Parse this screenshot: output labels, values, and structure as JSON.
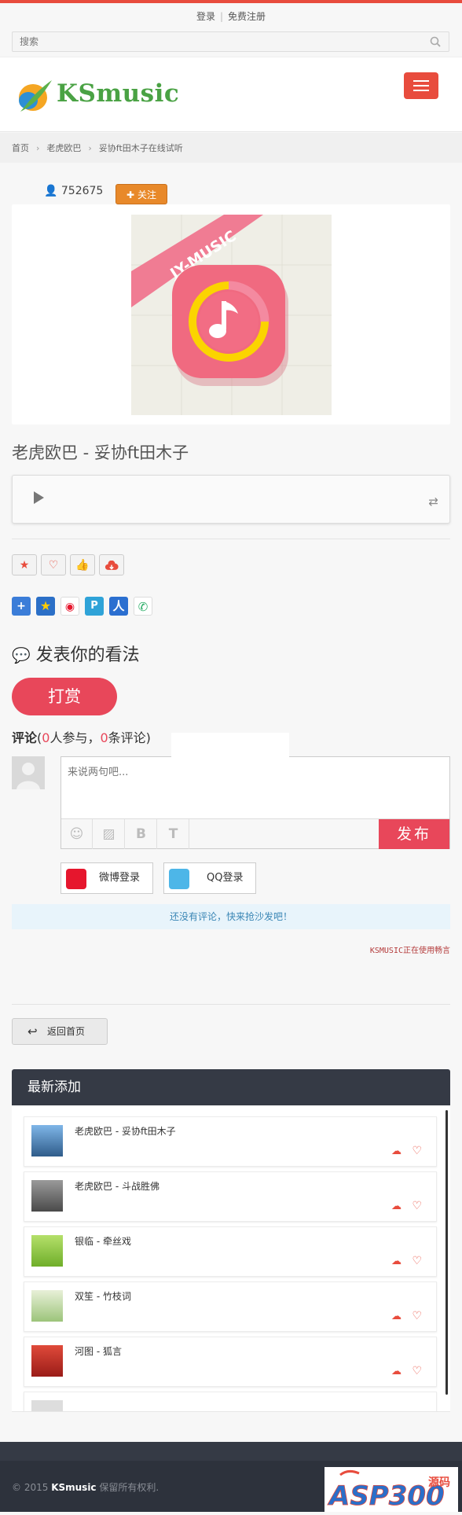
{
  "top": {
    "login": "登录",
    "register": "免费注册"
  },
  "search": {
    "placeholder": "搜索"
  },
  "header": {
    "logo_text": "KSmusic",
    "accent": "#e84c3d"
  },
  "breadcrumb": {
    "home": "首页",
    "artist": "老虎欧巴",
    "current": "妥协ft田木子在线试听"
  },
  "song": {
    "play_count": "752675",
    "follow_label": "关注",
    "cover_banner": "JY-MUSIC",
    "title": "老虎欧巴 - 妥协ft田木子"
  },
  "comments": {
    "heading": "发表你的看法",
    "reward_label": "打赏",
    "count_label": "评论",
    "participants": "0",
    "participants_label": "人参与，",
    "comments_num": "0",
    "comments_label": "条评论)",
    "input_placeholder": "来说两句吧...",
    "publish_label": "发布",
    "weibo_login": "微博登录",
    "qq_login": "QQ登录",
    "empty_notice": "还没有评论，快来抢沙发吧！",
    "powered_by": "KSMUSIC正在使用畅言"
  },
  "back": {
    "label": "返回首页"
  },
  "latest": {
    "title": "最新添加",
    "items": [
      {
        "name": "老虎欧巴 - 妥协ft田木子",
        "thumb_color": "#5a8fc8"
      },
      {
        "name": "老虎欧巴 - 斗战胜佛",
        "thumb_color": "#6b6b6b"
      },
      {
        "name": "银临 - 牵丝戏",
        "thumb_color": "#8cc63f"
      },
      {
        "name": "双笙 - 竹枝词",
        "thumb_color": "#b8d89a"
      },
      {
        "name": "河图 - 狐言",
        "thumb_color": "#c8322d"
      }
    ]
  },
  "footer": {
    "copyright_prefix": "© 2015",
    "brand": "KSmusic",
    "copyright_suffix": "保留所有权利.",
    "watermark": "ASP300",
    "watermark_sub": "源码"
  }
}
